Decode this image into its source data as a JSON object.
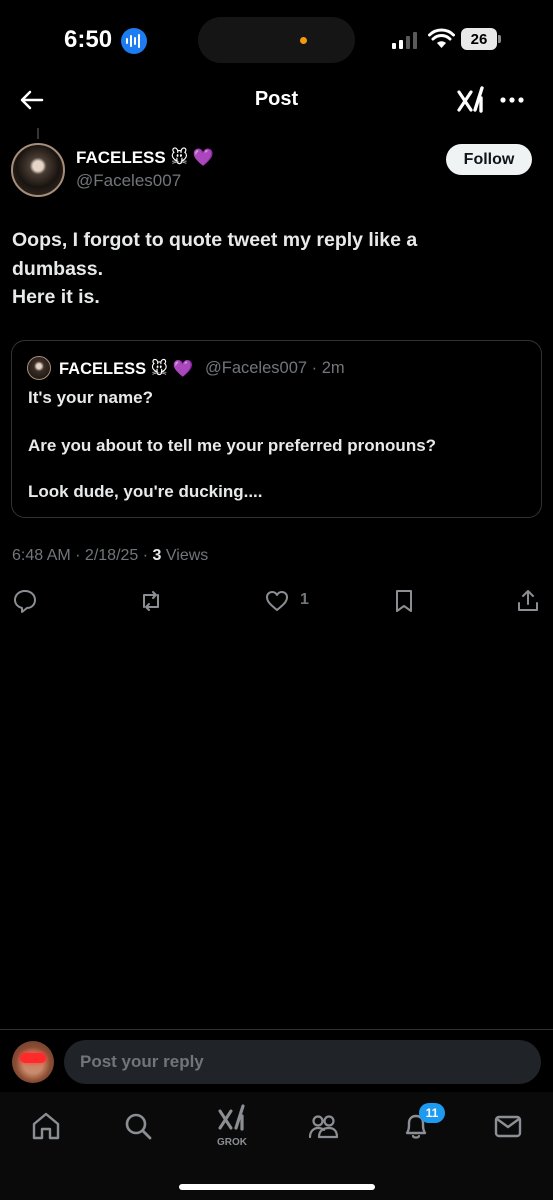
{
  "status_bar": {
    "time": "6:50",
    "battery": "26"
  },
  "header": {
    "title": "Post"
  },
  "post": {
    "author_name": "FACELESS 🐭 💜",
    "author_handle": "@Faceles007",
    "follow_label": "Follow",
    "text_lines": [
      "Oops, I forgot to quote tweet my reply like a",
      "dumbass.",
      "Here it is."
    ],
    "timestamp": "6:48 AM · 2/18/25 · ",
    "views_count": "3",
    "views_label": "Views",
    "like_count": "1"
  },
  "quote": {
    "author_name": "FACELESS 🐭 💜",
    "author_handle": "@Faceles007 · 2m",
    "lines": [
      "It's your name?",
      "Are you about to tell me your preferred pronouns?",
      "Look dude, you're ducking...."
    ]
  },
  "reply": {
    "placeholder": "Post your reply"
  },
  "bottom_nav": {
    "grok_label": "GROK",
    "notification_count": "11"
  },
  "colors": {
    "background": "#000000",
    "accent": "#1d9bf0",
    "muted": "#71767b"
  }
}
